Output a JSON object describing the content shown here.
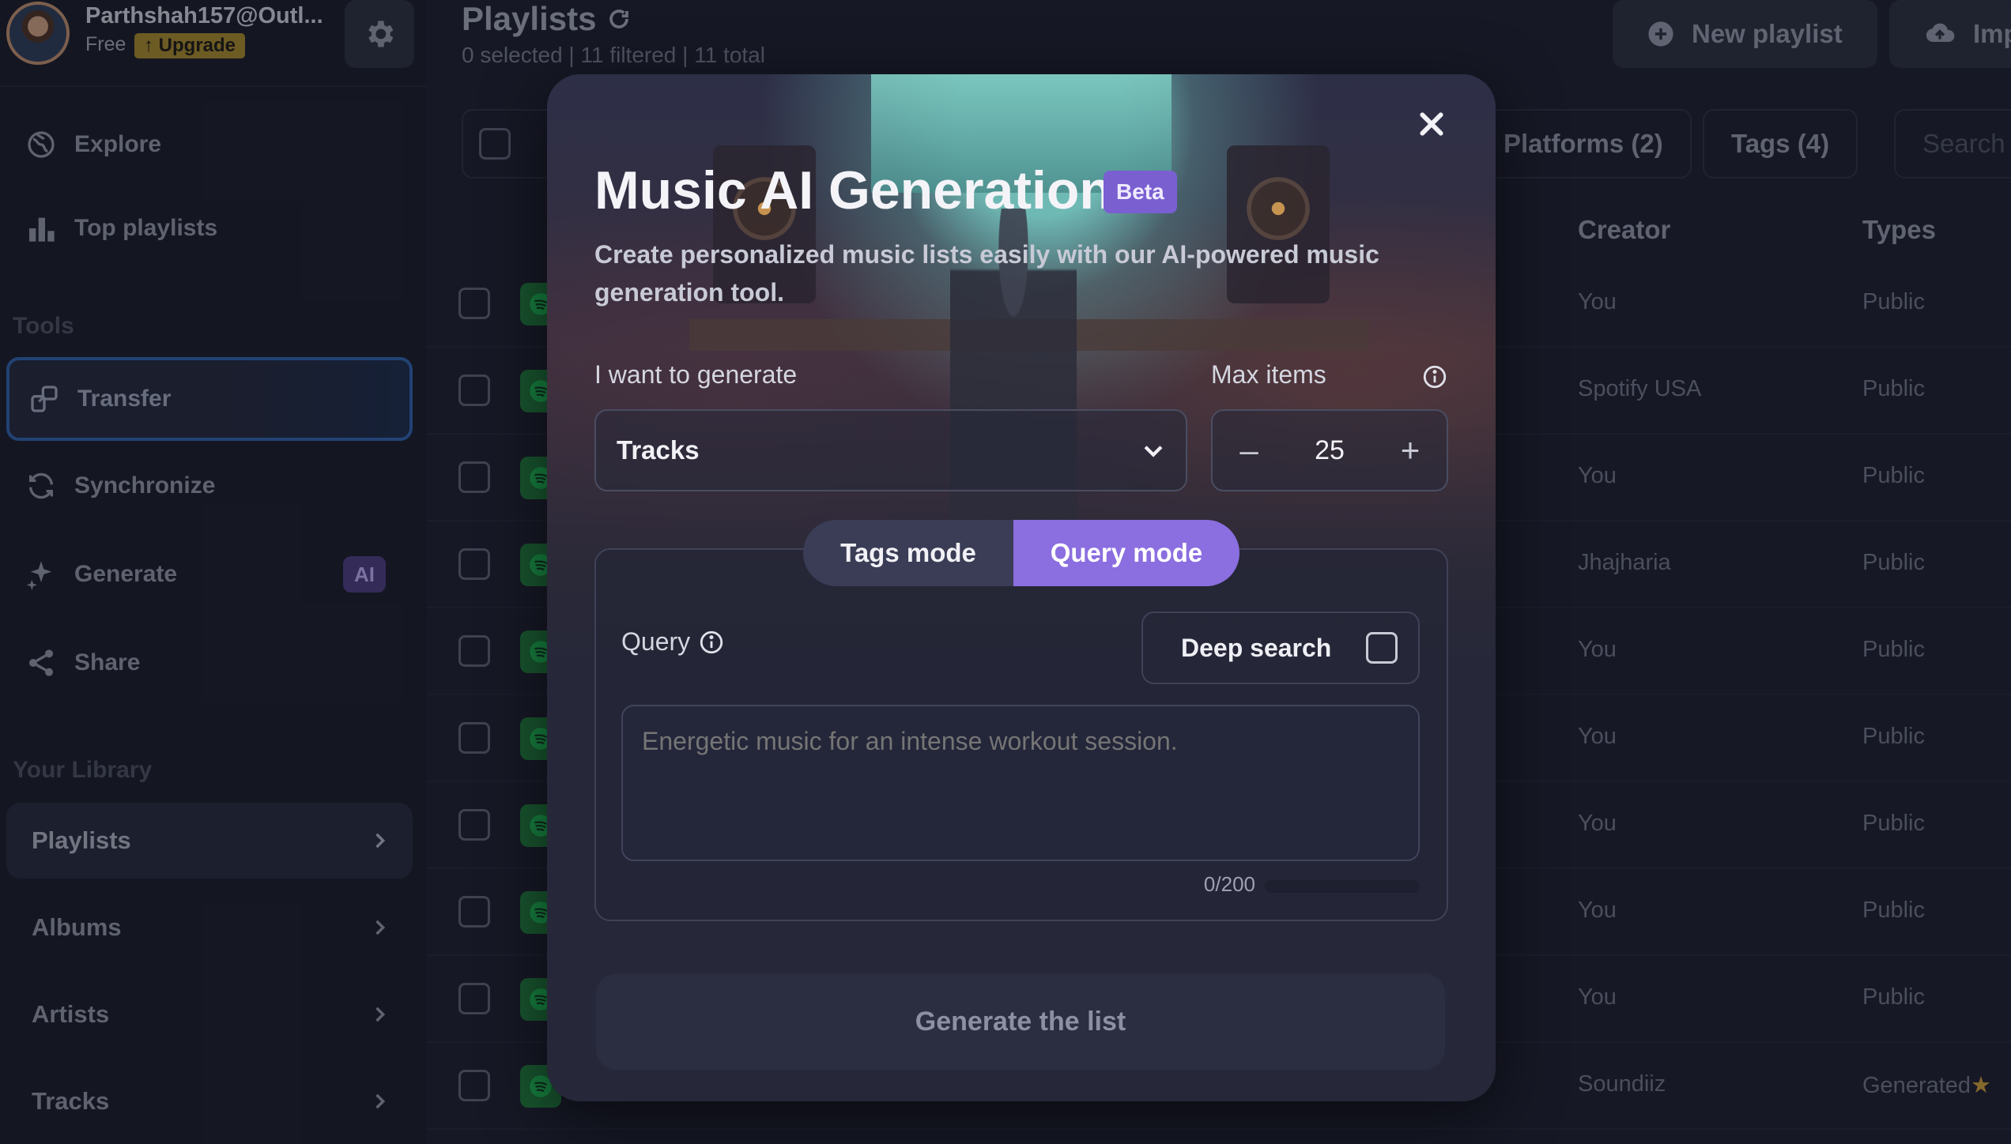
{
  "user": {
    "name": "Parthshah157@Outl...",
    "plan": "Free",
    "upgrade_label": "Upgrade"
  },
  "sidebar": {
    "explore": "Explore",
    "top_playlists": "Top playlists",
    "tools_label": "Tools",
    "tools": [
      {
        "label": "Transfer",
        "icon": "transfer-icon"
      },
      {
        "label": "Synchronize",
        "icon": "sync-icon"
      },
      {
        "label": "Generate",
        "icon": "sparkle-icon",
        "badge": "AI"
      },
      {
        "label": "Share",
        "icon": "share-icon"
      }
    ],
    "library_label": "Your Library",
    "library": [
      {
        "label": "Playlists"
      },
      {
        "label": "Albums"
      },
      {
        "label": "Artists"
      },
      {
        "label": "Tracks"
      }
    ]
  },
  "header": {
    "title": "Playlists",
    "subtitle": "0 selected | 11 filtered | 11 total",
    "new_playlist": "New playlist",
    "import": "Imp"
  },
  "filters": {
    "platforms": "Platforms (2)",
    "tags": "Tags (4)",
    "search_placeholder": "Search"
  },
  "table": {
    "columns": {
      "creator": "Creator",
      "types": "Types"
    },
    "rows": [
      {
        "creator": "You",
        "type": "Public"
      },
      {
        "creator": "Spotify USA",
        "type": "Public"
      },
      {
        "creator": "You",
        "type": "Public"
      },
      {
        "creator": "Jhajharia",
        "type": "Public"
      },
      {
        "creator": "You",
        "type": "Public"
      },
      {
        "creator": "You",
        "type": "Public"
      },
      {
        "creator": "You",
        "type": "Public"
      },
      {
        "creator": "You",
        "type": "Public"
      },
      {
        "creator": "You",
        "type": "Public"
      },
      {
        "creator": "Soundiiz",
        "type": "Generated"
      }
    ]
  },
  "modal": {
    "title": "Music AI Generation",
    "badge": "Beta",
    "description": "Create personalized music lists easily with our AI-powered music generation tool.",
    "generate_label": "I want to generate",
    "generate_value": "Tracks",
    "max_items_label": "Max items",
    "max_items_value": "25",
    "modes": {
      "tags": "Tags mode",
      "query": "Query mode",
      "active": "query"
    },
    "query_label": "Query",
    "deep_search_label": "Deep search",
    "query_placeholder": "Energetic music for an intense workout session.",
    "char_count": "0/200",
    "submit_label": "Generate the list"
  },
  "colors": {
    "accent": "#8b6ee0",
    "spotify_green": "#1f7a3b",
    "upgrade": "#a1842c"
  }
}
